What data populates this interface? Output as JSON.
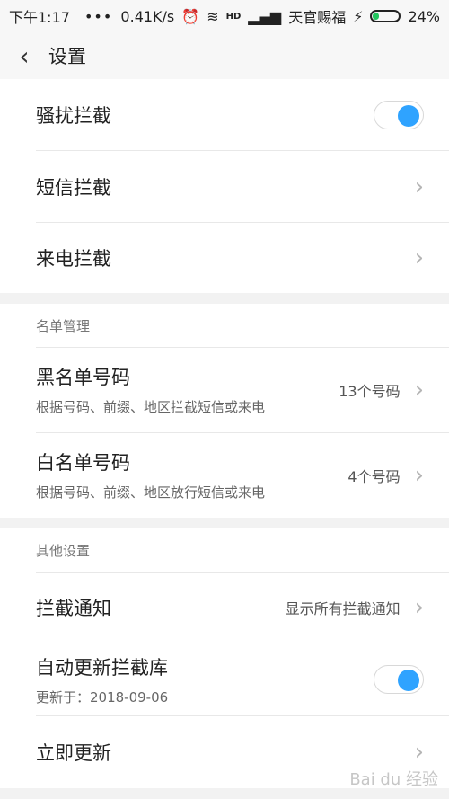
{
  "status_bar": {
    "time": "下午1:17",
    "dots": "•••",
    "speed": "0.41K/s",
    "carrier": "天官赐福",
    "battery": "24%",
    "icons": [
      "alarm-icon",
      "wifi-icon",
      "hd-icon",
      "signal-icon",
      "charging-icon",
      "battery-icon"
    ]
  },
  "header": {
    "back_icon": "chevron-left-icon",
    "title": "设置"
  },
  "section_1": {
    "items": [
      {
        "label": "骚扰拦截",
        "toggle_on": true
      },
      {
        "label": "短信拦截"
      },
      {
        "label": "来电拦截"
      }
    ]
  },
  "list_management": {
    "header": "名单管理",
    "items": [
      {
        "label": "黑名单号码",
        "sublabel": "根据号码、前缀、地区拦截短信或来电",
        "value": "13个号码"
      },
      {
        "label": "白名单号码",
        "sublabel": "根据号码、前缀、地区放行短信或来电",
        "value": "4个号码"
      }
    ]
  },
  "other_settings": {
    "header": "其他设置",
    "items": [
      {
        "label": "拦截通知",
        "value": "显示所有拦截通知"
      },
      {
        "label": "自动更新拦截库",
        "sublabel": "更新于：2018-09-06",
        "toggle_on": true
      },
      {
        "label": "立即更新"
      }
    ]
  },
  "watermark": "Bai du 经验"
}
